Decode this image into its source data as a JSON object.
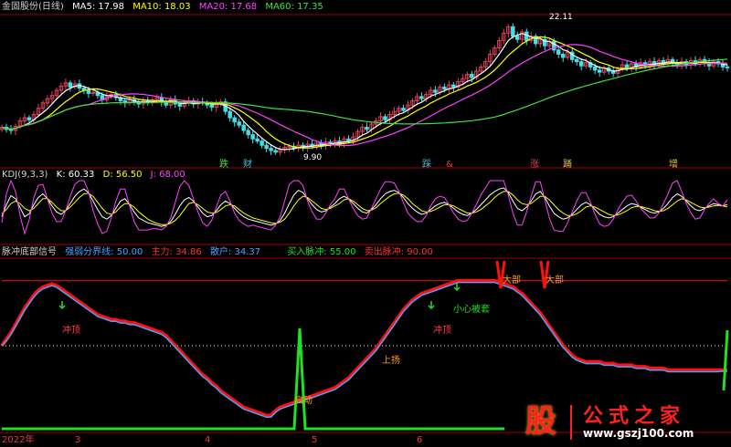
{
  "colors": {
    "bg": "#000000",
    "frame": "#a00000",
    "up": "#e0405a",
    "down": "#40e0e8",
    "ma5": "#ffffff",
    "ma10": "#ffff00",
    "ma20": "#ff40ff",
    "ma60": "#40e040",
    "kdj_k": "#ffffff",
    "kdj_d": "#ffff00",
    "kdj_j": "#ff40ff",
    "pulse_red": "#ff1010",
    "pulse_blue": "#4aa0ff",
    "pulse_green": "#20e020",
    "ref_line": "#ffffff"
  },
  "panel1": {
    "title": "金固股份(日线)",
    "ma5": "MA5: 17.98",
    "ma10": "MA10: 18.03",
    "ma20": "MA20: 17.68",
    "ma60": "MA60: 17.35",
    "high_label": "22.11",
    "low_label": "9.90",
    "markers": [
      "跌",
      "财",
      "踩",
      "&",
      "涨",
      "踊",
      "增"
    ]
  },
  "panel2": {
    "title": "KDJ(9,3,3)",
    "k": "K: 60.33",
    "d": "D: 56.50",
    "j": "J: 68.00"
  },
  "panel3": {
    "title": "脉冲底部信号",
    "strong_weak": "强弱分界线: 50.00",
    "main": "主力: 34.86",
    "retail": "散户: 34.37",
    "buy": "买入脉冲: 55.00",
    "sell": "卖出脉冲: 90.00",
    "annotations": {
      "chongding1": "冲顶",
      "qidong": "启动",
      "shangyang": "上扬",
      "chongding2": "冲顶",
      "xiaoxin": "小心被套",
      "dabu1": "大部",
      "dabu2": "大部"
    }
  },
  "xaxis": {
    "labels": [
      "2022年",
      "3",
      "4",
      "5",
      "6"
    ]
  },
  "watermark": {
    "logo_char": "股",
    "title": "公式之家",
    "url": "www.gszj100.com"
  },
  "chart_data": [
    {
      "type": "candlestick",
      "title": "金固股份(日线)",
      "annotations": [
        "22.11",
        "9.90"
      ],
      "x": [
        0,
        1,
        2,
        3,
        4,
        5,
        6,
        7,
        8,
        9,
        10,
        11,
        12,
        13,
        14,
        15,
        16,
        17,
        18,
        19,
        20,
        21,
        22,
        23,
        24,
        25,
        26,
        27,
        28,
        29,
        30,
        31,
        32,
        33,
        34,
        35,
        36,
        37,
        38,
        39,
        40,
        41,
        42,
        43,
        44,
        45,
        46,
        47,
        48,
        49,
        50,
        51,
        52,
        53,
        54,
        55,
        56,
        57,
        58,
        59,
        60,
        61,
        62,
        63,
        64,
        65,
        66,
        67,
        68,
        69,
        70,
        71,
        72,
        73,
        74,
        75,
        76,
        77,
        78,
        79,
        80,
        81,
        82,
        83,
        84,
        85,
        86,
        87,
        88,
        89,
        90,
        91,
        92,
        93,
        94,
        95,
        96,
        97,
        98,
        99,
        100,
        101,
        102,
        103,
        104,
        105,
        106,
        107,
        108,
        109,
        110,
        111,
        112,
        113,
        114,
        115,
        116,
        117,
        118,
        119,
        120,
        121,
        122,
        123,
        124,
        125,
        126,
        127,
        128,
        129,
        130,
        131,
        132,
        133,
        134,
        135,
        136,
        137,
        138,
        139,
        140,
        141,
        142,
        143,
        144,
        145,
        146,
        147,
        148,
        149,
        150,
        151,
        152,
        153,
        154,
        155,
        156,
        157,
        158,
        159
      ],
      "close": [
        12.3,
        12.1,
        12.0,
        12.4,
        12.9,
        13.2,
        13.0,
        13.5,
        14.1,
        14.6,
        15.0,
        15.3,
        15.8,
        16.2,
        16.5,
        16.1,
        16.4,
        16.0,
        15.8,
        15.5,
        15.6,
        15.3,
        14.9,
        15.2,
        15.4,
        15.1,
        14.8,
        14.6,
        14.9,
        14.7,
        14.5,
        14.8,
        14.6,
        14.9,
        15.1,
        14.7,
        14.4,
        14.9,
        14.5,
        14.3,
        14.6,
        14.8,
        14.5,
        14.7,
        14.6,
        14.4,
        14.2,
        14.5,
        14.7,
        13.8,
        13.2,
        12.8,
        12.5,
        12.0,
        11.6,
        11.2,
        11.0,
        10.6,
        10.3,
        10.1,
        9.95,
        10.2,
        10.4,
        10.5,
        10.3,
        10.6,
        10.4,
        10.7,
        10.5,
        10.8,
        10.6,
        10.9,
        10.7,
        11.0,
        10.8,
        11.2,
        11.0,
        11.4,
        11.9,
        12.3,
        12.1,
        12.6,
        12.9,
        13.3,
        13.0,
        13.5,
        13.8,
        14.1,
        13.9,
        14.4,
        14.8,
        15.2,
        15.0,
        15.4,
        15.8,
        15.6,
        16.1,
        15.9,
        16.3,
        16.1,
        16.6,
        16.9,
        17.3,
        17.0,
        17.6,
        18.0,
        18.5,
        19.2,
        19.8,
        20.5,
        21.2,
        21.8,
        20.9,
        20.6,
        21.3,
        20.5,
        20.9,
        20.2,
        20.6,
        20.0,
        20.4,
        19.6,
        19.2,
        18.9,
        19.4,
        18.7,
        18.5,
        18.1,
        18.4,
        18.0,
        17.7,
        17.5,
        17.9,
        17.6,
        17.4,
        17.8,
        18.2,
        17.9,
        18.3,
        18.0,
        18.4,
        18.1,
        18.5,
        18.2,
        18.6,
        18.3,
        18.7,
        18.4,
        18.1,
        18.5,
        18.2,
        18.6,
        18.3,
        18.7,
        18.4,
        18.1,
        18.5,
        18.3,
        18.0,
        17.98
      ]
    },
    {
      "type": "line",
      "title": "KDJ(9,3,3)",
      "series": [
        {
          "name": "K",
          "values": [
            40,
            60,
            75,
            70,
            55,
            40,
            45,
            60,
            72,
            78,
            70,
            58,
            48,
            44,
            50,
            62,
            74,
            82,
            86,
            80,
            66,
            52,
            40,
            36,
            42,
            54,
            66,
            70,
            60,
            48,
            38,
            34,
            30,
            28,
            26,
            24,
            26,
            32,
            44,
            58,
            68,
            72,
            66,
            56,
            46,
            40,
            42,
            50,
            60,
            66,
            62,
            54,
            46,
            40,
            36,
            34,
            32,
            30,
            28,
            26,
            28,
            34,
            46,
            62,
            76,
            84,
            80,
            70,
            60,
            52,
            48,
            50,
            56,
            62,
            70,
            74,
            70,
            62,
            54,
            48,
            46,
            52,
            60,
            70,
            78,
            82,
            84,
            80,
            72,
            62,
            54,
            48,
            44,
            46,
            52,
            58,
            62,
            64,
            60,
            54,
            48,
            44,
            42,
            46,
            52,
            60,
            68,
            76,
            82,
            86,
            88,
            80,
            66,
            54,
            50,
            56,
            66,
            78,
            82,
            72,
            58,
            46,
            40,
            36,
            38,
            44,
            52,
            60,
            64,
            60,
            52,
            44,
            40,
            38,
            40,
            46,
            52,
            58,
            62,
            60,
            56,
            52,
            48,
            46,
            48,
            54,
            62,
            72,
            78,
            74,
            66,
            58,
            52,
            50,
            54,
            58,
            62,
            60,
            58,
            60.33
          ]
        },
        {
          "name": "D",
          "values": [
            45,
            52,
            62,
            66,
            62,
            54,
            50,
            54,
            62,
            70,
            70,
            64,
            56,
            50,
            50,
            56,
            64,
            72,
            78,
            79,
            74,
            64,
            54,
            46,
            44,
            48,
            56,
            62,
            61,
            56,
            48,
            42,
            36,
            32,
            29,
            27,
            27,
            29,
            34,
            42,
            52,
            62,
            64,
            60,
            54,
            48,
            46,
            47,
            52,
            58,
            60,
            58,
            52,
            46,
            42,
            38,
            36,
            34,
            32,
            30,
            29,
            31,
            36,
            46,
            58,
            68,
            74,
            72,
            66,
            60,
            54,
            52,
            54,
            58,
            62,
            68,
            70,
            66,
            60,
            54,
            50,
            51,
            55,
            62,
            68,
            74,
            78,
            79,
            76,
            70,
            62,
            56,
            50,
            48,
            49,
            52,
            56,
            60,
            60,
            58,
            54,
            50,
            46,
            46,
            48,
            52,
            58,
            64,
            72,
            78,
            82,
            82,
            76,
            68,
            62,
            60,
            62,
            68,
            74,
            74,
            68,
            60,
            52,
            46,
            42,
            42,
            45,
            50,
            56,
            58,
            56,
            52,
            48,
            44,
            42,
            43,
            46,
            50,
            55,
            57,
            57,
            55,
            53,
            50,
            49,
            50,
            54,
            60,
            66,
            70,
            68,
            64,
            60,
            56,
            55,
            56,
            58,
            59,
            58,
            56.5
          ]
        },
        {
          "name": "J",
          "values": [
            30,
            78,
            100,
            82,
            42,
            12,
            35,
            72,
            92,
            94,
            70,
            46,
            32,
            32,
            50,
            74,
            94,
            100,
            100,
            82,
            50,
            28,
            12,
            16,
            38,
            66,
            86,
            86,
            58,
            32,
            18,
            18,
            18,
            20,
            20,
            18,
            24,
            38,
            64,
            90,
            100,
            92,
            70,
            48,
            30,
            24,
            34,
            56,
            76,
            82,
            66,
            46,
            34,
            28,
            24,
            26,
            24,
            22,
            20,
            18,
            26,
            40,
            66,
            94,
            100,
            100,
            92,
            66,
            48,
            36,
            36,
            46,
            60,
            70,
            86,
            86,
            70,
            54,
            42,
            36,
            38,
            54,
            70,
            86,
            98,
            98,
            96,
            82,
            64,
            46,
            38,
            32,
            32,
            42,
            58,
            70,
            74,
            72,
            60,
            46,
            36,
            32,
            34,
            46,
            60,
            76,
            88,
            100,
            100,
            100,
            100,
            76,
            46,
            26,
            26,
            48,
            74,
            98,
            98,
            68,
            38,
            18,
            16,
            16,
            30,
            48,
            66,
            80,
            80,
            64,
            44,
            28,
            24,
            26,
            36,
            52,
            64,
            74,
            76,
            66,
            54,
            46,
            38,
            38,
            46,
            62,
            78,
            96,
            100,
            82,
            62,
            46,
            36,
            38,
            52,
            62,
            70,
            62,
            58,
            68
          ]
        }
      ]
    },
    {
      "type": "line",
      "title": "脉冲底部信号",
      "annotations": [
        "冲顶",
        "启动",
        "上扬",
        "冲顶",
        "小心被套",
        "大部",
        "大部"
      ],
      "reference_lines": [
        50,
        90
      ],
      "series": [
        {
          "name": "主力",
          "values": [
            50,
            54,
            58,
            63,
            68,
            73,
            77,
            81,
            84,
            86,
            87,
            88,
            87,
            85,
            83,
            81,
            79,
            77,
            75,
            73,
            71,
            69,
            68,
            67,
            66,
            66,
            65,
            65,
            64,
            64,
            63,
            62,
            61,
            60,
            59,
            58,
            56,
            53,
            50,
            47,
            44,
            41,
            38,
            35,
            32,
            30,
            27,
            25,
            22,
            20,
            18,
            16,
            14,
            12,
            11,
            10,
            9,
            8,
            7,
            7,
            10,
            12,
            13,
            14,
            15,
            16,
            17,
            18,
            19,
            20,
            21,
            22,
            23,
            24,
            26,
            28,
            30,
            33,
            36,
            39,
            42,
            45,
            48,
            52,
            56,
            60,
            64,
            68,
            72,
            75,
            78,
            80,
            82,
            83,
            84,
            85,
            86,
            87,
            88,
            89,
            90,
            90,
            90,
            90,
            90,
            90,
            90,
            90,
            90,
            89,
            88,
            87,
            86,
            84,
            82,
            79,
            76,
            73,
            70,
            66,
            62,
            58,
            54,
            50,
            47,
            44,
            42,
            41,
            40,
            40,
            40,
            40,
            39,
            39,
            39,
            38,
            38,
            38,
            38,
            37,
            37,
            37,
            36,
            36,
            36,
            36,
            35,
            35,
            35,
            35,
            35,
            35,
            35,
            35,
            35,
            35,
            35,
            35,
            34.9,
            34.86
          ]
        },
        {
          "name": "散户",
          "values": [
            50,
            53,
            57,
            62,
            67,
            72,
            76,
            80,
            83,
            85,
            86,
            87,
            86,
            84,
            82,
            80,
            78,
            76,
            74,
            72,
            70,
            68,
            67,
            66,
            65,
            65,
            64,
            64,
            63,
            63,
            62,
            61,
            60,
            59,
            58,
            57,
            55,
            52,
            49,
            46,
            43,
            40,
            37,
            34,
            31,
            29,
            26,
            24,
            21,
            19,
            17,
            15,
            13,
            11,
            10,
            9,
            8,
            7,
            6,
            6,
            9,
            11,
            12,
            13,
            14,
            15,
            16,
            17,
            18,
            19,
            20,
            21,
            22,
            23,
            25,
            27,
            29,
            32,
            35,
            38,
            41,
            44,
            47,
            51,
            55,
            59,
            63,
            67,
            71,
            74,
            77,
            79,
            81,
            82,
            83,
            84,
            85,
            86,
            87,
            88,
            89,
            89,
            89,
            89,
            89,
            89,
            89,
            89,
            89,
            88,
            87,
            86,
            85,
            83,
            81,
            78,
            75,
            72,
            69,
            65,
            61,
            57,
            53,
            49,
            46,
            43,
            41,
            40,
            39,
            39,
            39,
            39,
            38,
            38,
            38,
            37,
            37,
            37,
            37,
            36,
            36,
            36,
            35,
            35,
            35,
            35,
            34,
            34,
            34,
            34,
            34,
            34,
            34,
            34,
            34,
            34,
            34,
            34,
            34.4,
            34.37
          ]
        }
      ]
    }
  ]
}
